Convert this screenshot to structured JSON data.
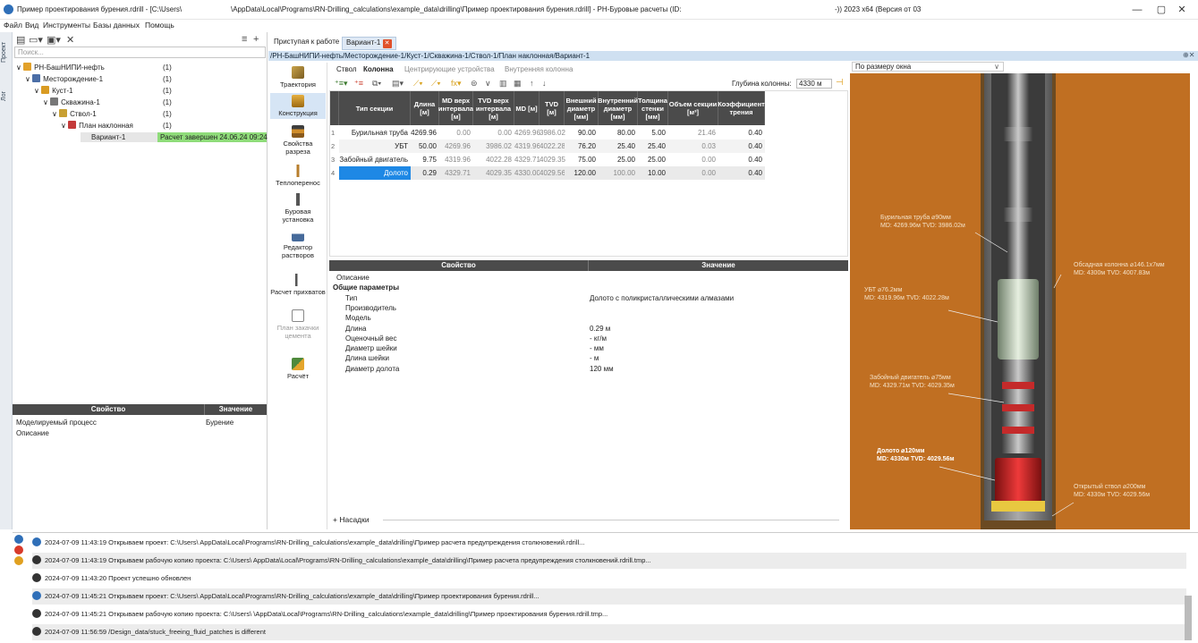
{
  "window": {
    "title": "Пример проектирования бурения.rdrill - [C:\\Users\\",
    "title_mid": "\\AppData\\Local\\Programs\\RN-Drilling_calculations\\example_data\\drilling\\Пример проектирования бурения.rdrill] - РН-Буровые расчеты (ID:",
    "title_right": "-)) 2023 x64 (Версия от 03",
    "min": "—",
    "max": "▢",
    "close": "✕"
  },
  "menu": [
    "Файл",
    "Вид",
    "Инструменты",
    "Базы данных",
    "Помощь"
  ],
  "side_tabs": [
    "Проект",
    "Лог"
  ],
  "search": {
    "placeholder": "Поиск..."
  },
  "tree": [
    {
      "label": "РН-БашНИПИ-нефть",
      "count": "(1)",
      "color": "#e2a12a"
    },
    {
      "label": "Месторождение-1",
      "count": "(1)",
      "color": "#4b6ea6"
    },
    {
      "label": "Куст-1",
      "count": "(1)",
      "color": "#d99b22"
    },
    {
      "label": "Скважина-1",
      "count": "(1)",
      "color": "#777"
    },
    {
      "label": "Ствол-1",
      "count": "(1)",
      "color": "#c8a033"
    },
    {
      "label": "План наклонная",
      "count": "(1)",
      "color": "#c43a3a"
    },
    {
      "label": "Вариант-1",
      "status": "Расчет завершен 24.06.24 09:24"
    }
  ],
  "left_props": {
    "headers": [
      "Свойство",
      "Значение"
    ],
    "rows": [
      [
        "Моделируемый процесс",
        "Бурение"
      ],
      [
        "Описание",
        ""
      ]
    ]
  },
  "doc_tabs": [
    "Приступая к работе",
    "Вариант-1"
  ],
  "path": "/РН-БашНИПИ-нефть/Месторождение-1/Куст-1/Скважина-1/Ствол-1/План наклонная/Вариант-1",
  "sidebar": [
    "Траектория",
    "Конструкция",
    "Свойства разреза",
    "Теплоперенос",
    "Буровая установка",
    "Редактор растворов",
    "Расчет прихватов",
    "План закачки цемента",
    "Расчёт"
  ],
  "subtabs": [
    "Ствол",
    "Колонна",
    "Центрирующие устройства",
    "Внутренняя колонна"
  ],
  "depth": {
    "label": "Глубина колонны:",
    "value": "4330 м"
  },
  "grid": {
    "headers": [
      "Тип секции",
      "Длина [м]",
      "MD верх интервала [м]",
      "TVD верх интервала [м]",
      "MD [м]",
      "TVD [м]",
      "Внешний диаметр [мм]",
      "Внутренний диаметр [мм]",
      "Толщина стенки [мм]",
      "Объем секции [м³]",
      "Коэффициент трения"
    ],
    "rows": [
      [
        "1",
        "Бурильная труба",
        "4269.96",
        "0.00",
        "0.00",
        "4269.96",
        "3986.02",
        "90.00",
        "80.00",
        "5.00",
        "21.46",
        "0.40"
      ],
      [
        "2",
        "УБТ",
        "50.00",
        "4269.96",
        "3986.02",
        "4319.96",
        "4022.28",
        "76.20",
        "25.40",
        "25.40",
        "0.03",
        "0.40"
      ],
      [
        "3",
        "Забойный двигатель",
        "9.75",
        "4319.96",
        "4022.28",
        "4329.71",
        "4029.35",
        "75.00",
        "25.00",
        "25.00",
        "0.00",
        "0.40"
      ],
      [
        "4",
        "Долото",
        "0.29",
        "4329.71",
        "4029.35",
        "4330.00",
        "4029.56",
        "120.00",
        "100.00",
        "10.00",
        "0.00",
        "0.40"
      ]
    ]
  },
  "props": {
    "headers": [
      "Свойство",
      "Значение"
    ],
    "rows": [
      {
        "k": "Описание",
        "v": "",
        "lvl": 0
      },
      {
        "k": "Общие параметры",
        "v": "",
        "lvl": 0,
        "bold": true
      },
      {
        "k": "Тип",
        "v": "Долото с поликристаллическими алмазами",
        "lvl": 1
      },
      {
        "k": "Производитель",
        "v": "",
        "lvl": 1
      },
      {
        "k": "Модель",
        "v": "",
        "lvl": 1
      },
      {
        "k": "Длина",
        "v": "0.29 м",
        "lvl": 1
      },
      {
        "k": "Оценочный вес",
        "v": "- кг/м",
        "lvl": 1
      },
      {
        "k": "Диаметр шейки",
        "v": "- мм",
        "lvl": 1
      },
      {
        "k": "Длина шейки",
        "v": "- м",
        "lvl": 1
      },
      {
        "k": "Диаметр долота",
        "v": "120 мм",
        "lvl": 1
      }
    ],
    "nozzles": "+ Насадки"
  },
  "viz": {
    "zoom": "По размеру окна",
    "labels": [
      [
        "Бурильная труба ⌀90мм",
        "MD: 4269.96м  TVD: 3986.02м"
      ],
      [
        "Обсадная колонна ⌀146.1х7мм",
        "MD: 4300м  TVD: 4007.83м"
      ],
      [
        "УБТ ⌀76.2мм",
        "MD: 4319.96м  TVD: 4022.28м"
      ],
      [
        "Забойный двигатель ⌀75мм",
        "MD: 4329.71м  TVD: 4029.35м"
      ],
      [
        "Долото ⌀120мм",
        "MD: 4330м  TVD: 4029.56м"
      ],
      [
        "Открытый ствол ⌀200мм",
        "MD: 4330м  TVD: 4029.56м"
      ]
    ]
  },
  "log": [
    "2024-07-09 11:43:19  Открываем проект: C:\\Users\\           AppData\\Local\\Programs\\RN-Drilling_calculations\\example_data\\drilling\\Пример расчета предупреждения столкновений.rdrill...",
    "2024-07-09 11:43:19  Открываем рабочую копию проекта: C:\\Users\\           AppData\\Local\\Programs\\RN-Drilling_calculations\\example_data\\drilling\\Пример расчета предупреждения столкновений.rdrill.tmp...",
    "2024-07-09 11:43:20  Проект успешно обновлен",
    "2024-07-09 11:45:21  Открываем проект: C:\\Users\\           AppData\\Local\\Programs\\RN-Drilling_calculations\\example_data\\drilling\\Пример проектирования бурения.rdrill...",
    "2024-07-09 11:45:21  Открываем рабочую копию проекта: C:\\Users\\           \\AppData\\Local\\Programs\\RN-Drilling_calculations\\example_data\\drilling\\Пример проектирования бурения.rdrill.tmp...",
    "2024-07-09 11:56:59  /Design_data/stuck_freeing_fluid_patches is different"
  ]
}
